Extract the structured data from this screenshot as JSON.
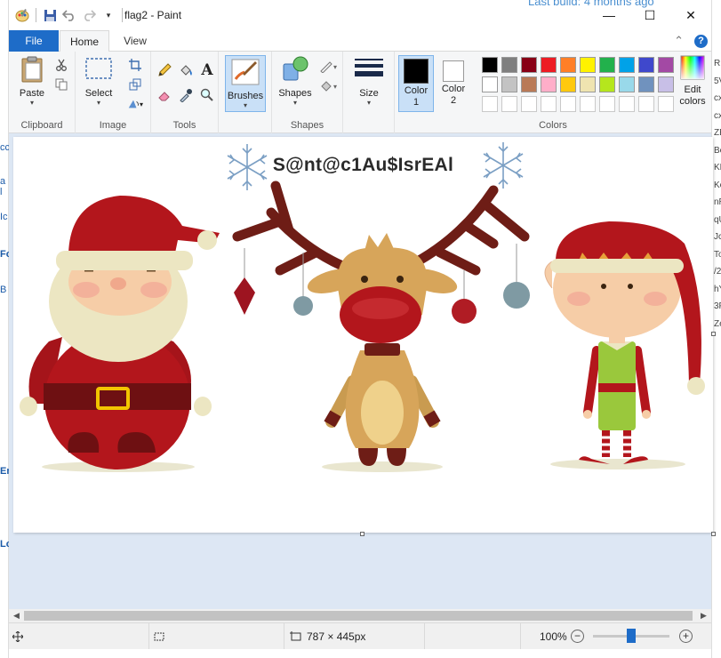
{
  "background": {
    "top_text": "Last build: 4 months ago",
    "right_fragments": [
      "RE",
      "5V",
      "cx",
      "cx",
      "ZE",
      "Be",
      "KF",
      "Ke",
      "nR",
      "qU",
      "Jc",
      "To",
      "/2",
      "hY",
      "3F",
      "Ze"
    ],
    "left_fragments": [
      "cc",
      "a l",
      "Ic",
      "Fo",
      "B",
      "En",
      "Lo"
    ]
  },
  "window": {
    "title": "flag2 - Paint",
    "minimize": "—",
    "maximize": "☐",
    "close": "✕"
  },
  "tabs": {
    "file": "File",
    "home": "Home",
    "view": "View",
    "collapse": "⌃",
    "help": "?"
  },
  "ribbon": {
    "clipboard": {
      "label": "Clipboard",
      "paste": "Paste"
    },
    "image": {
      "label": "Image",
      "select": "Select"
    },
    "tools": {
      "label": "Tools"
    },
    "brushes": {
      "label": "Brushes"
    },
    "shapes": {
      "label": "Shapes",
      "button": "Shapes"
    },
    "size": {
      "label": "Size"
    },
    "colors": {
      "label": "Colors",
      "color1_line1": "Color",
      "color1_line2": "1",
      "color2_line1": "Color",
      "color2_line2": "2",
      "edit_line1": "Edit",
      "edit_line2": "colors",
      "color1_value": "#000000",
      "color2_value": "#ffffff",
      "palette_row1": [
        "#000000",
        "#7f7f7f",
        "#880015",
        "#ed1c24",
        "#ff7f27",
        "#fff200",
        "#22b14c",
        "#00a2e8",
        "#3f48cc",
        "#a349a4"
      ],
      "palette_row2": [
        "#ffffff",
        "#c3c3c3",
        "#b97a57",
        "#ffaec9",
        "#ffc90e",
        "#efe4b0",
        "#b5e61d",
        "#99d9ea",
        "#7092be",
        "#c8bfe7"
      ]
    }
  },
  "canvas": {
    "title": "S@nt@c1Au$IsrEAl"
  },
  "status": {
    "size": "787 × 445px",
    "zoom": "100%",
    "zoom_level_fraction": 0.5
  }
}
